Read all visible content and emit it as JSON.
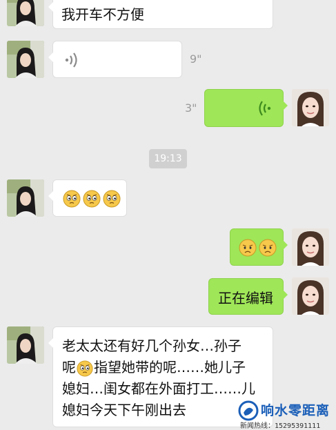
{
  "messages": {
    "m1_text": "我开车不方便",
    "m2_duration": "9\"",
    "m3_duration": "3\"",
    "timestamp": "19:13",
    "m5_text": "正在编辑",
    "m6_line1": "老太太还有好几个孙女…孙子",
    "m6_line2": "指望她带的呢……她儿子",
    "m6_line2_prefix": "呢",
    "m6_line3": "媳妇…闺女都在外面打工……儿",
    "m6_line4": "媳妇今天下午刚出去"
  },
  "icons": {
    "voice_left": "voice-wave-left-icon",
    "voice_right": "voice-wave-right-icon",
    "emoji": "worried-face-emoji",
    "emoji_sad": "frowning-face-emoji"
  },
  "watermark": {
    "title": "响水零距离",
    "hotline": "新闻热线：15295391111"
  },
  "colors": {
    "background": "#ebebeb",
    "sent_bubble": "#9fe658",
    "received_bubble": "#ffffff",
    "timestamp_badge": "#d0d0d0",
    "brand": "#1b5fb8"
  }
}
